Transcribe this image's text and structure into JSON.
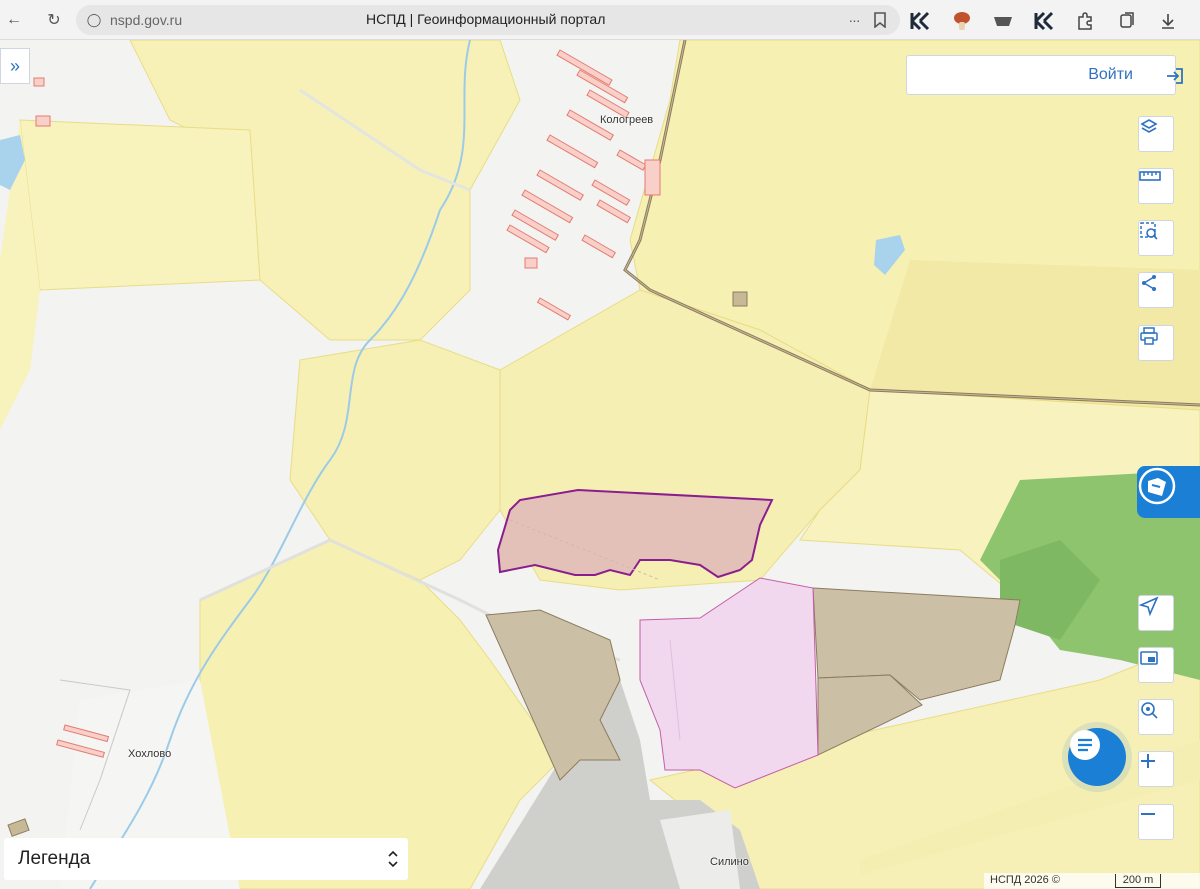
{
  "browser": {
    "url": "nspd.gov.ru",
    "tab_title": "НСПД | Геоинформационный портал",
    "back_icon": "arrow-left-icon",
    "reload_icon": "reload-icon",
    "more": "···"
  },
  "map": {
    "login_label": "Войти",
    "legend_label": "Легенда",
    "places": {
      "kologreevo": "Кологреев",
      "khokhlovo": "Хохлово",
      "silino": "Силино"
    },
    "copyright": "НСПД 2026 ©",
    "scale_label": "200 m",
    "controls": [
      "layers-icon",
      "ruler-icon",
      "select-area-icon",
      "share-icon",
      "print-icon",
      "locate-icon",
      "minimap-icon",
      "geo-search-icon",
      "zoom-in-icon",
      "zoom-out-icon"
    ],
    "colors": {
      "field": "#f7f0b5",
      "field_dark": "#f2e9a6",
      "forest": "#8fc46f",
      "water": "#a9d3ec",
      "parcel_selected": "#e3c1b8",
      "parcel_selected_stroke": "#8b1e8e",
      "parcel_pink": "#f1d8ee",
      "parcel_brown": "#ccc1a8",
      "building": "#f2a7a0",
      "accent": "#1b7fd6"
    }
  }
}
